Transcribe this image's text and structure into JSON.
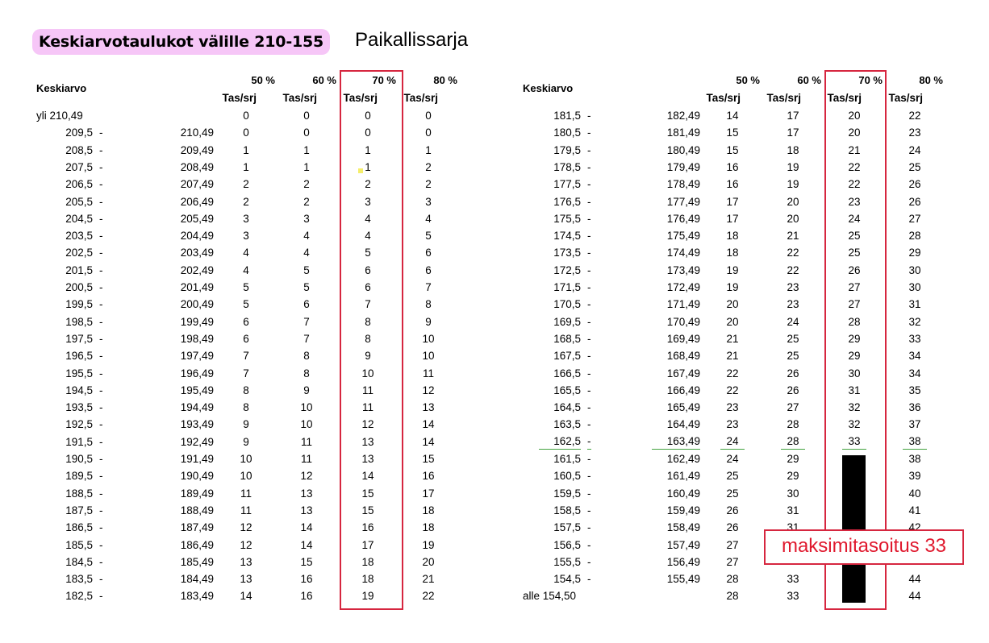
{
  "title": "Keskiarvotaulukot välille 210-155",
  "subtitle": "Paikallissarja",
  "left_table": {
    "row_label_header": "Keskiarvo",
    "percent_headers": [
      "50 %",
      "60 %",
      "70 %",
      "80 %"
    ],
    "sub_headers": [
      "Tas/srj",
      "Tas/srj",
      "Tas/srj",
      "Tas/srj"
    ],
    "first_row": {
      "label": "yli 210,49",
      "values": [
        "0",
        "0",
        "0",
        "0"
      ]
    },
    "rows": [
      {
        "from": "209,5",
        "dash": "-",
        "to": "210,49",
        "values": [
          "0",
          "0",
          "0",
          "0"
        ]
      },
      {
        "from": "208,5",
        "dash": "-",
        "to": "209,49",
        "values": [
          "1",
          "1",
          "1",
          "1"
        ]
      },
      {
        "from": "207,5",
        "dash": "-",
        "to": "208,49",
        "values": [
          "1",
          "1",
          "1",
          "2"
        ]
      },
      {
        "from": "206,5",
        "dash": "-",
        "to": "207,49",
        "values": [
          "2",
          "2",
          "2",
          "2"
        ]
      },
      {
        "from": "205,5",
        "dash": "-",
        "to": "206,49",
        "values": [
          "2",
          "2",
          "3",
          "3"
        ]
      },
      {
        "from": "204,5",
        "dash": "-",
        "to": "205,49",
        "values": [
          "3",
          "3",
          "4",
          "4"
        ]
      },
      {
        "from": "203,5",
        "dash": "-",
        "to": "204,49",
        "values": [
          "3",
          "4",
          "4",
          "5"
        ]
      },
      {
        "from": "202,5",
        "dash": "-",
        "to": "203,49",
        "values": [
          "4",
          "4",
          "5",
          "6"
        ]
      },
      {
        "from": "201,5",
        "dash": "-",
        "to": "202,49",
        "values": [
          "4",
          "5",
          "6",
          "6"
        ]
      },
      {
        "from": "200,5",
        "dash": "-",
        "to": "201,49",
        "values": [
          "5",
          "5",
          "6",
          "7"
        ]
      },
      {
        "from": "199,5",
        "dash": "-",
        "to": "200,49",
        "values": [
          "5",
          "6",
          "7",
          "8"
        ]
      },
      {
        "from": "198,5",
        "dash": "-",
        "to": "199,49",
        "values": [
          "6",
          "7",
          "8",
          "9"
        ]
      },
      {
        "from": "197,5",
        "dash": "-",
        "to": "198,49",
        "values": [
          "6",
          "7",
          "8",
          "10"
        ]
      },
      {
        "from": "196,5",
        "dash": "-",
        "to": "197,49",
        "values": [
          "7",
          "8",
          "9",
          "10"
        ]
      },
      {
        "from": "195,5",
        "dash": "-",
        "to": "196,49",
        "values": [
          "7",
          "8",
          "10",
          "11"
        ]
      },
      {
        "from": "194,5",
        "dash": "-",
        "to": "195,49",
        "values": [
          "8",
          "9",
          "11",
          "12"
        ]
      },
      {
        "from": "193,5",
        "dash": "-",
        "to": "194,49",
        "values": [
          "8",
          "10",
          "11",
          "13"
        ]
      },
      {
        "from": "192,5",
        "dash": "-",
        "to": "193,49",
        "values": [
          "9",
          "10",
          "12",
          "14"
        ]
      },
      {
        "from": "191,5",
        "dash": "-",
        "to": "192,49",
        "values": [
          "9",
          "11",
          "13",
          "14"
        ]
      },
      {
        "from": "190,5",
        "dash": "-",
        "to": "191,49",
        "values": [
          "10",
          "11",
          "13",
          "15"
        ]
      },
      {
        "from": "189,5",
        "dash": "-",
        "to": "190,49",
        "values": [
          "10",
          "12",
          "14",
          "16"
        ]
      },
      {
        "from": "188,5",
        "dash": "-",
        "to": "189,49",
        "values": [
          "11",
          "13",
          "15",
          "17"
        ]
      },
      {
        "from": "187,5",
        "dash": "-",
        "to": "188,49",
        "values": [
          "11",
          "13",
          "15",
          "18"
        ]
      },
      {
        "from": "186,5",
        "dash": "-",
        "to": "187,49",
        "values": [
          "12",
          "14",
          "16",
          "18"
        ]
      },
      {
        "from": "185,5",
        "dash": "-",
        "to": "186,49",
        "values": [
          "12",
          "14",
          "17",
          "19"
        ]
      },
      {
        "from": "184,5",
        "dash": "-",
        "to": "185,49",
        "values": [
          "13",
          "15",
          "18",
          "20"
        ]
      },
      {
        "from": "183,5",
        "dash": "-",
        "to": "184,49",
        "values": [
          "13",
          "16",
          "18",
          "21"
        ]
      },
      {
        "from": "182,5",
        "dash": "-",
        "to": "183,49",
        "values": [
          "14",
          "16",
          "19",
          "22"
        ]
      }
    ]
  },
  "right_table": {
    "row_label_header": "Keskiarvo",
    "percent_headers": [
      "50 %",
      "60 %",
      "70 %",
      "80 %"
    ],
    "sub_headers": [
      "Tas/srj",
      "Tas/srj",
      "Tas/srj",
      "Tas/srj"
    ],
    "rows": [
      {
        "from": "181,5",
        "dash": "-",
        "to": "182,49",
        "values": [
          "14",
          "17",
          "20",
          "22"
        ]
      },
      {
        "from": "180,5",
        "dash": "-",
        "to": "181,49",
        "values": [
          "15",
          "17",
          "20",
          "23"
        ]
      },
      {
        "from": "179,5",
        "dash": "-",
        "to": "180,49",
        "values": [
          "15",
          "18",
          "21",
          "24"
        ]
      },
      {
        "from": "178,5",
        "dash": "-",
        "to": "179,49",
        "values": [
          "16",
          "19",
          "22",
          "25"
        ]
      },
      {
        "from": "177,5",
        "dash": "-",
        "to": "178,49",
        "values": [
          "16",
          "19",
          "22",
          "26"
        ]
      },
      {
        "from": "176,5",
        "dash": "-",
        "to": "177,49",
        "values": [
          "17",
          "20",
          "23",
          "26"
        ]
      },
      {
        "from": "175,5",
        "dash": "-",
        "to": "176,49",
        "values": [
          "17",
          "20",
          "24",
          "27"
        ]
      },
      {
        "from": "174,5",
        "dash": "-",
        "to": "175,49",
        "values": [
          "18",
          "21",
          "25",
          "28"
        ]
      },
      {
        "from": "173,5",
        "dash": "-",
        "to": "174,49",
        "values": [
          "18",
          "22",
          "25",
          "29"
        ]
      },
      {
        "from": "172,5",
        "dash": "-",
        "to": "173,49",
        "values": [
          "19",
          "22",
          "26",
          "30"
        ]
      },
      {
        "from": "171,5",
        "dash": "-",
        "to": "172,49",
        "values": [
          "19",
          "23",
          "27",
          "30"
        ]
      },
      {
        "from": "170,5",
        "dash": "-",
        "to": "171,49",
        "values": [
          "20",
          "23",
          "27",
          "31"
        ]
      },
      {
        "from": "169,5",
        "dash": "-",
        "to": "170,49",
        "values": [
          "20",
          "24",
          "28",
          "32"
        ]
      },
      {
        "from": "168,5",
        "dash": "-",
        "to": "169,49",
        "values": [
          "21",
          "25",
          "29",
          "33"
        ]
      },
      {
        "from": "167,5",
        "dash": "-",
        "to": "168,49",
        "values": [
          "21",
          "25",
          "29",
          "34"
        ]
      },
      {
        "from": "166,5",
        "dash": "-",
        "to": "167,49",
        "values": [
          "22",
          "26",
          "30",
          "34"
        ]
      },
      {
        "from": "165,5",
        "dash": "-",
        "to": "166,49",
        "values": [
          "22",
          "26",
          "31",
          "35"
        ]
      },
      {
        "from": "164,5",
        "dash": "-",
        "to": "165,49",
        "values": [
          "23",
          "27",
          "32",
          "36"
        ]
      },
      {
        "from": "163,5",
        "dash": "-",
        "to": "164,49",
        "values": [
          "23",
          "28",
          "32",
          "37"
        ]
      },
      {
        "from": "162,5",
        "dash": "-",
        "to": "163,49",
        "values": [
          "24",
          "28",
          "33",
          "38"
        ]
      },
      {
        "from": "161,5",
        "dash": "-",
        "to": "162,49",
        "values": [
          "24",
          "29",
          "",
          "38"
        ]
      },
      {
        "from": "160,5",
        "dash": "-",
        "to": "161,49",
        "values": [
          "25",
          "29",
          "",
          "39"
        ]
      },
      {
        "from": "159,5",
        "dash": "-",
        "to": "160,49",
        "values": [
          "25",
          "30",
          "",
          "40"
        ]
      },
      {
        "from": "158,5",
        "dash": "-",
        "to": "159,49",
        "values": [
          "26",
          "31",
          "",
          "41"
        ]
      },
      {
        "from": "157,5",
        "dash": "-",
        "to": "158,49",
        "values": [
          "26",
          "31",
          "",
          "42"
        ]
      },
      {
        "from": "156,5",
        "dash": "-",
        "to": "157,49",
        "values": [
          "27",
          "",
          "",
          ""
        ]
      },
      {
        "from": "155,5",
        "dash": "-",
        "to": "156,49",
        "values": [
          "27",
          "",
          "",
          ""
        ]
      },
      {
        "from": "154,5",
        "dash": "-",
        "to": "155,49",
        "values": [
          "28",
          "33",
          "",
          "44"
        ]
      }
    ],
    "last_row": {
      "label": "alle 154,50",
      "values": [
        "28",
        "33",
        "",
        "44"
      ]
    },
    "highlight_row_index": 19
  },
  "callout": "maksimitasoitus 33",
  "colors": {
    "title_bg": "#f6c6f7",
    "box_border": "#d6263f",
    "callout_text": "#e0192e",
    "underline": "#44a340",
    "redaction": "#000000"
  }
}
